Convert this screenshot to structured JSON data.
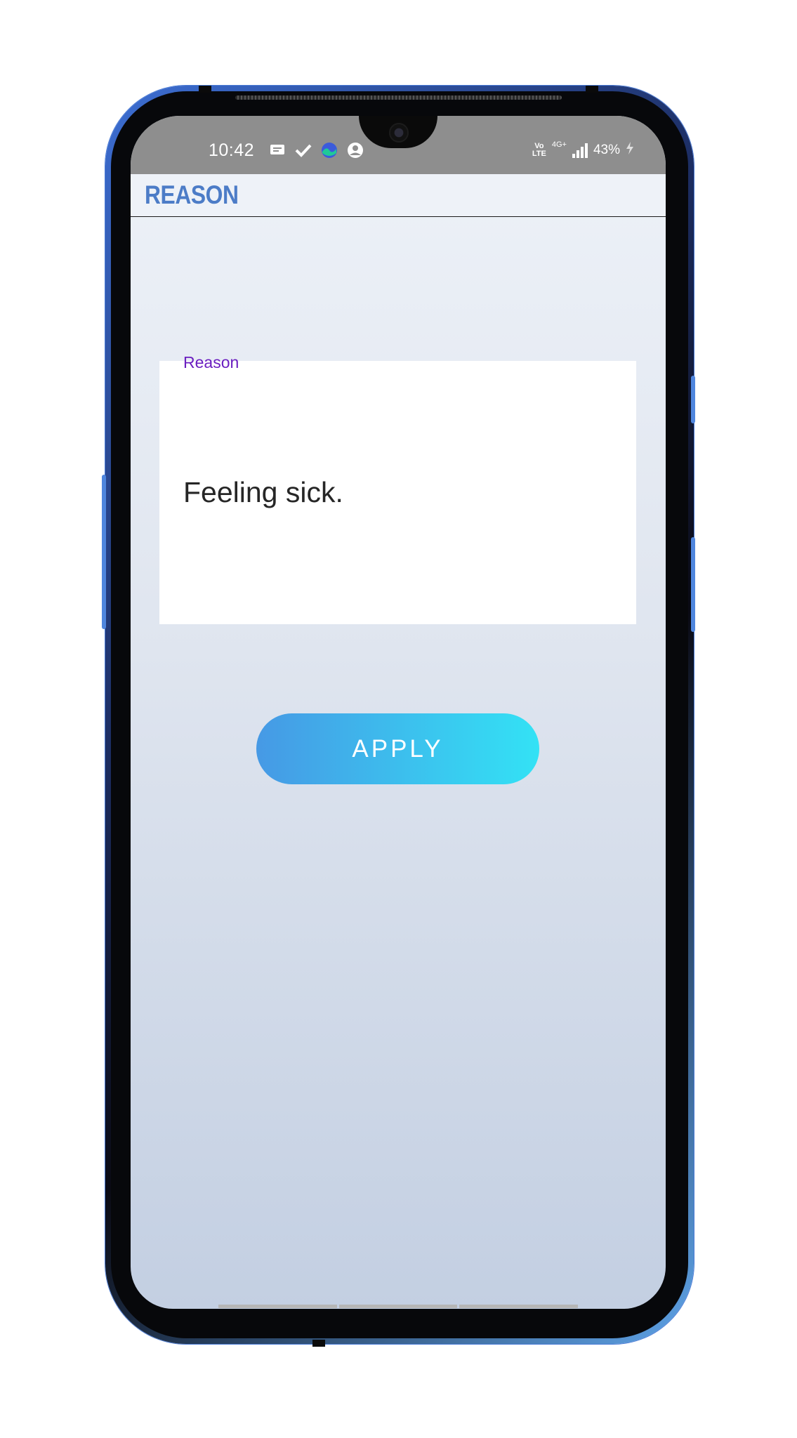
{
  "status_bar": {
    "time": "10:42",
    "icons_left": [
      "message-icon",
      "check-icon",
      "app-status-icon",
      "account-icon"
    ],
    "volte_line1": "Vo",
    "volte_line2": "LTE",
    "network": "4G+",
    "battery": "43%"
  },
  "app_bar": {
    "title": "REASON"
  },
  "form": {
    "reason_label": "Reason",
    "reason_value": "Feeling sick."
  },
  "actions": {
    "apply_label": "APPLY"
  },
  "colors": {
    "title": "#4c7cc7",
    "label_accent": "#6b1fc0",
    "button_gradient_start": "#4699e5",
    "button_gradient_end": "#33e2f5"
  }
}
